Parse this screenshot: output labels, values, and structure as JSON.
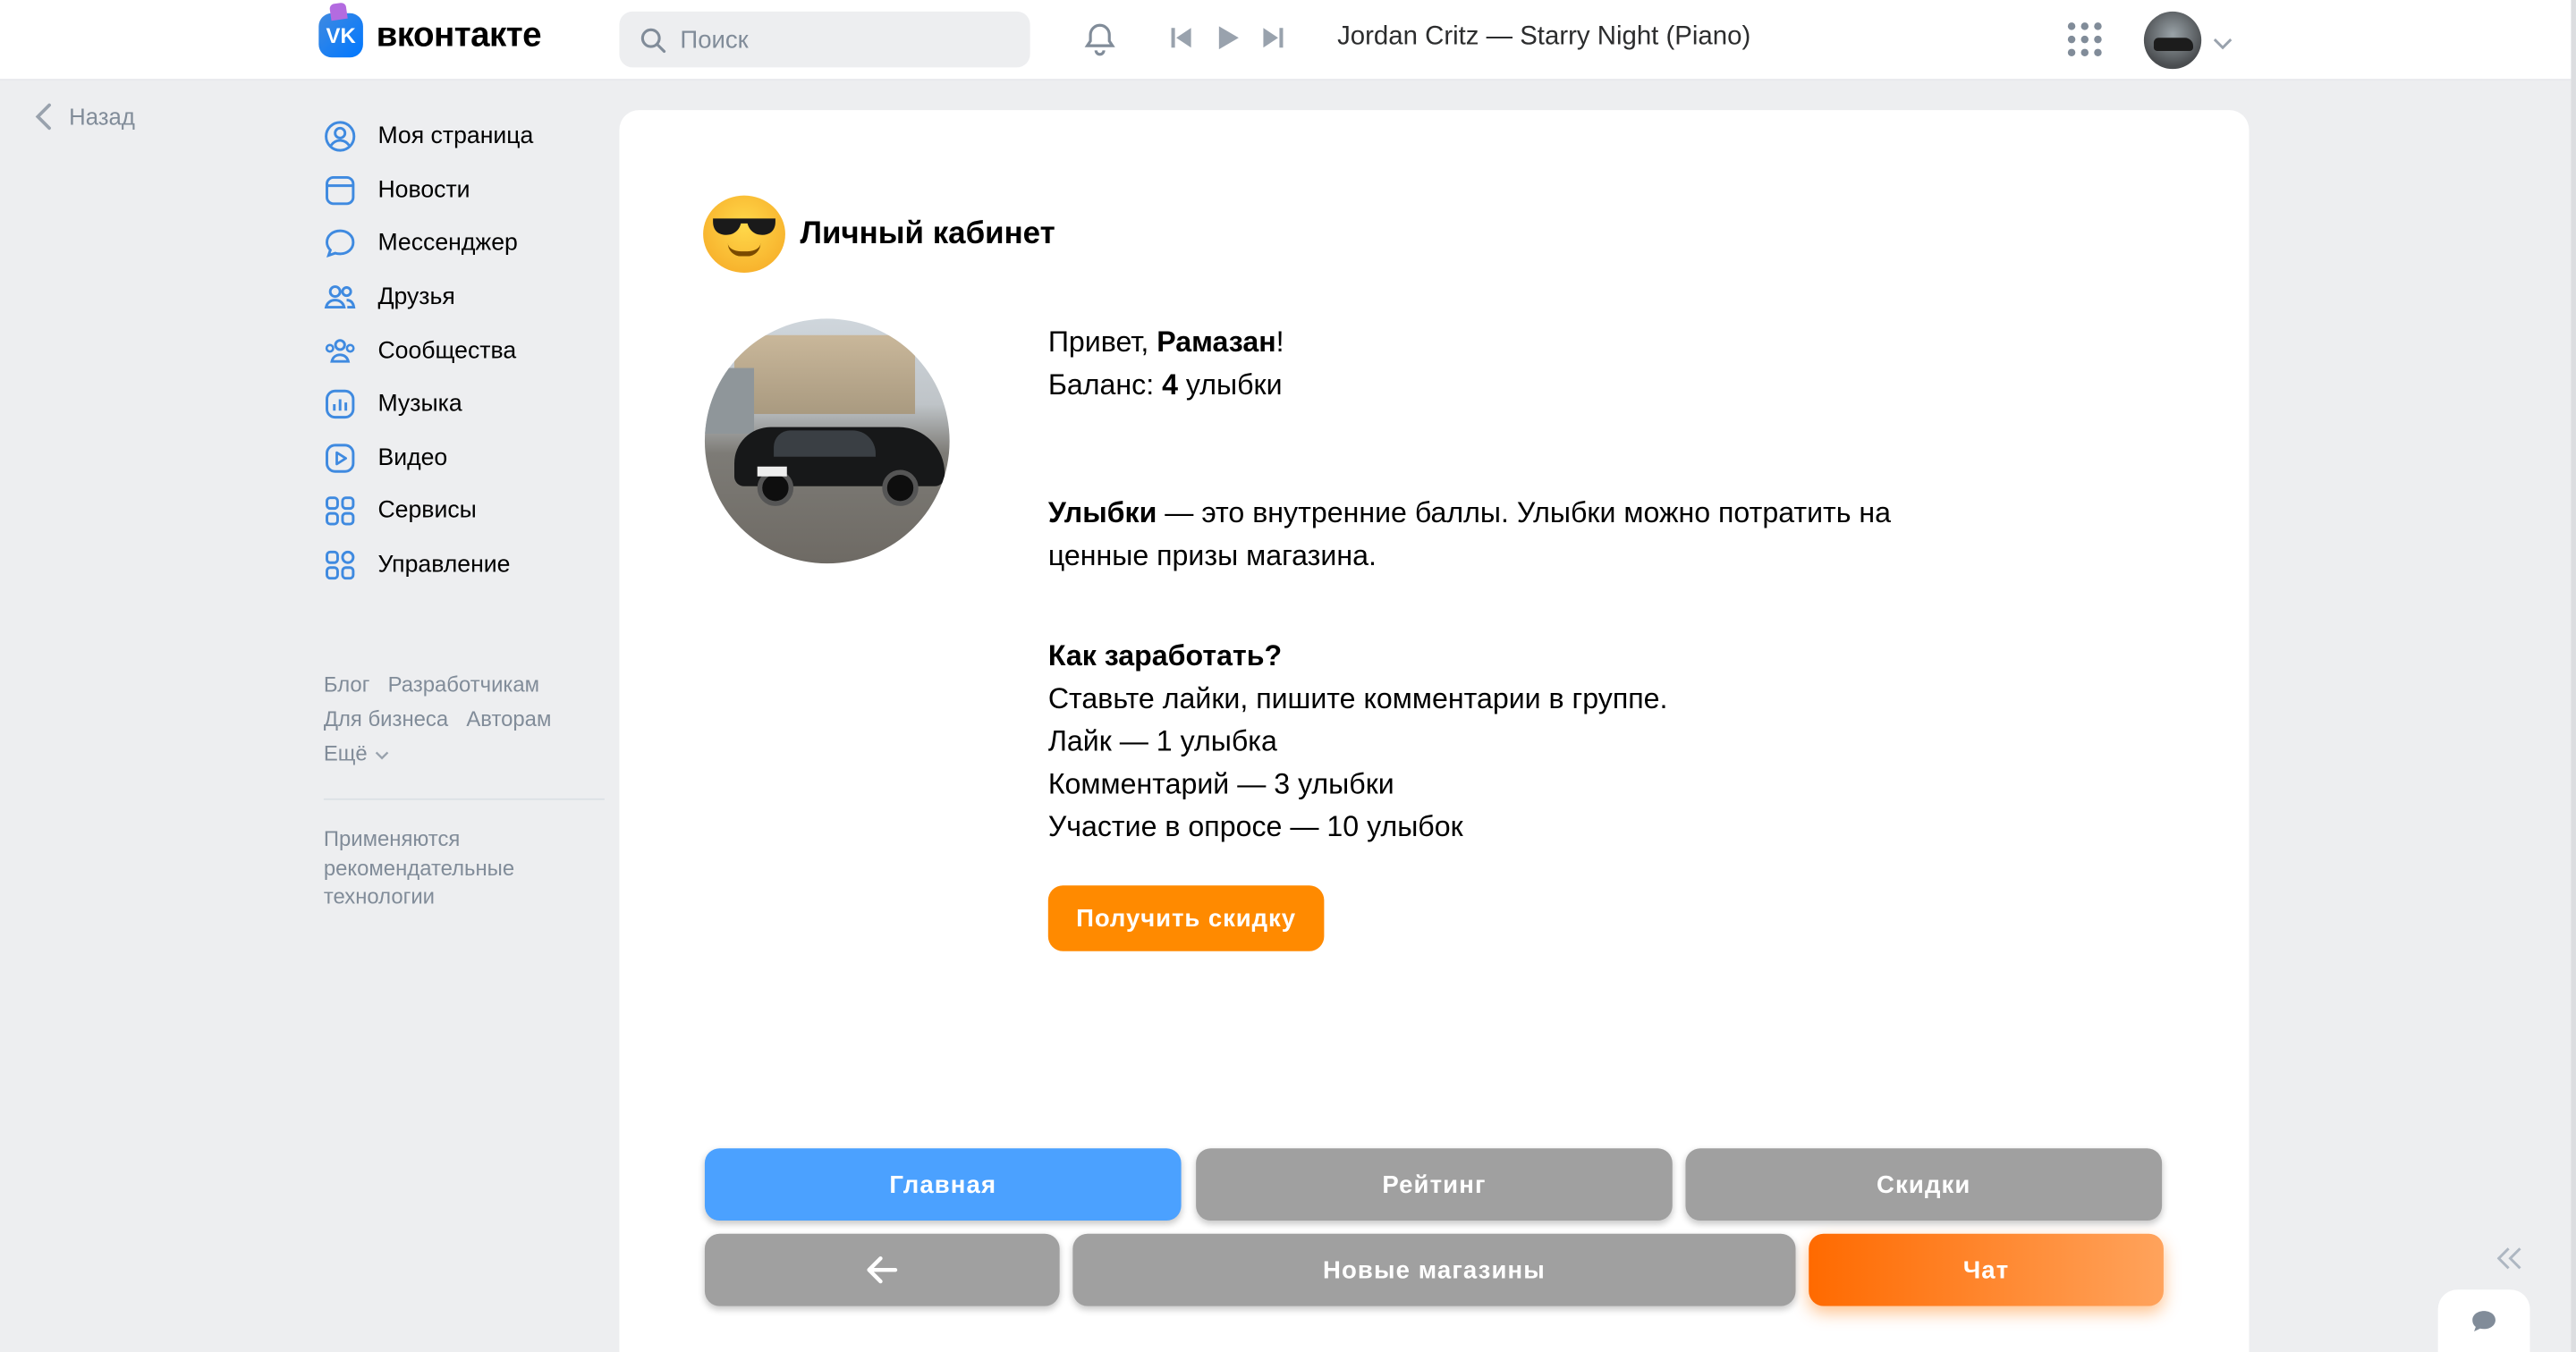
{
  "header": {
    "logo_text": "вконтакте",
    "search_placeholder": "Поиск",
    "now_playing": "Jordan Critz — Starry Night (Piano)"
  },
  "sidebar": {
    "back_label": "Назад",
    "items": [
      {
        "label": "Моя страница",
        "icon": "user-circle-icon"
      },
      {
        "label": "Новости",
        "icon": "news-icon"
      },
      {
        "label": "Мессенджер",
        "icon": "message-icon"
      },
      {
        "label": "Друзья",
        "icon": "friends-icon"
      },
      {
        "label": "Сообщества",
        "icon": "communities-icon"
      },
      {
        "label": "Музыка",
        "icon": "music-icon"
      },
      {
        "label": "Видео",
        "icon": "video-icon"
      },
      {
        "label": "Сервисы",
        "icon": "services-icon"
      },
      {
        "label": "Управление",
        "icon": "manage-icon"
      }
    ],
    "footer_links": [
      "Блог",
      "Разработчикам",
      "Для бизнеса",
      "Авторам",
      "Ещё"
    ],
    "recommendation_note": "Применяются рекомендательные технологии"
  },
  "main": {
    "title": "Личный кабинет",
    "greeting_prefix": "Привет, ",
    "user_name": "Рамазан",
    "greeting_suffix": "!",
    "balance_label": "Баланс: ",
    "balance_value": "4",
    "balance_unit": " улыбки",
    "about_term": "Улыбки",
    "about_text": " — это внутренние баллы. Улыбки можно потратить на ценные призы магазина.",
    "how_title": "Как заработать?",
    "how_lines": [
      "Ставьте лайки, пишите комментарии в группе.",
      "Лайк — 1 улыбка",
      "Комментарий — 3 улыбки",
      "Участие в опросе — 10 улыбок"
    ],
    "discount_button": "Получить скидку"
  },
  "tabs": {
    "home": "Главная",
    "rating": "Рейтинг",
    "discounts": "Скидки",
    "new_shops": "Новые магазины",
    "chat": "Чат"
  },
  "colors": {
    "accent_blue": "#4ba1ff",
    "accent_orange": "#ff8a00",
    "tab_gray": "#a0a0a0"
  }
}
